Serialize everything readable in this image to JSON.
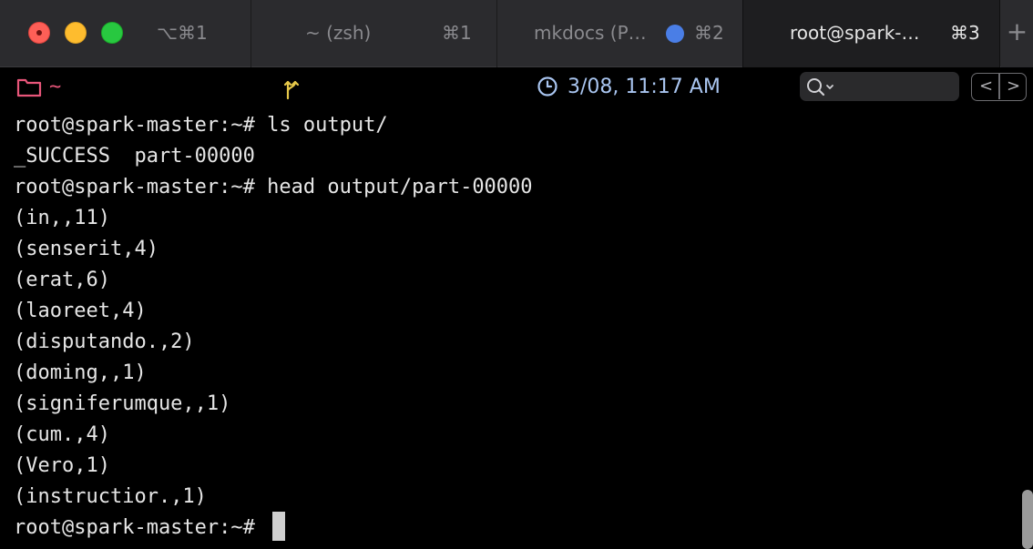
{
  "tabs": {
    "shortcut_label": "⌥⌘1",
    "tab1": {
      "title": "~ (zsh)",
      "shortcut": "⌘1"
    },
    "tab2": {
      "title": "mkdocs (P…",
      "shortcut": "⌘2",
      "dot_color": "#4a7ee6"
    },
    "tab3": {
      "title": "root@spark-…",
      "shortcut": "⌘3"
    },
    "new_tab": "+"
  },
  "status": {
    "cwd": "~",
    "datetime": "3/08, 11:17 AM",
    "search_placeholder": "",
    "back": "<",
    "forward": ">"
  },
  "colors": {
    "cwd": "#e8567a",
    "datetime": "#a9c5f0",
    "git_icon": "#e6c84a"
  },
  "terminal": {
    "lines": [
      "root@spark-master:~# ls output/",
      "_SUCCESS  part-00000",
      "root@spark-master:~# head output/part-00000",
      "(in,,11)",
      "(senserit,4)",
      "(erat,6)",
      "(laoreet,4)",
      "(disputando.,2)",
      "(doming,,1)",
      "(signiferumque,,1)",
      "(cum.,4)",
      "(Vero,1)",
      "(instructior.,1)",
      "root@spark-master:~# "
    ]
  }
}
